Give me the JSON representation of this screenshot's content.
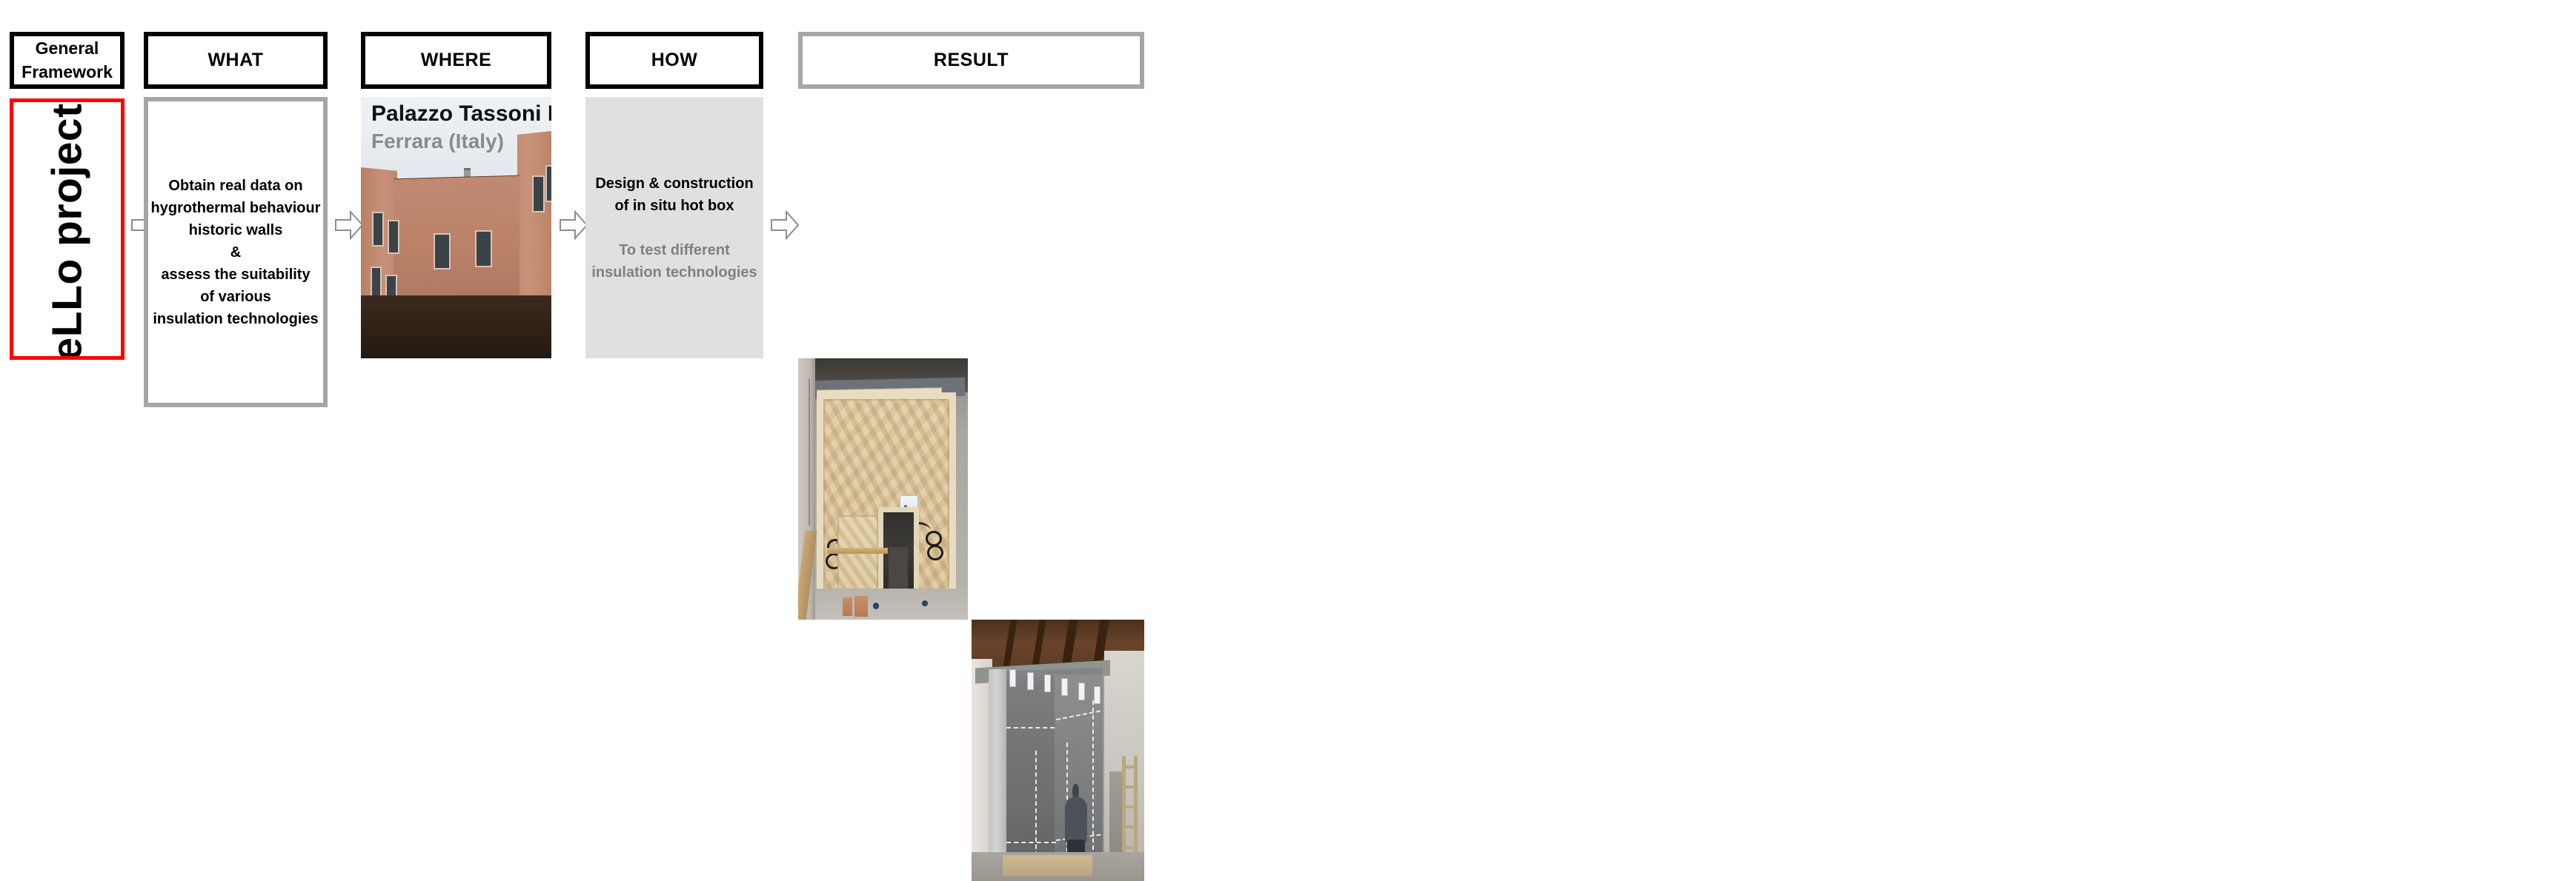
{
  "framework": {
    "header_line1": "General",
    "header_line2": "Framework",
    "goals_label": "The HeLLo project goals",
    "accent_color": "#ff0000"
  },
  "columns": {
    "what": {
      "header": "WHAT",
      "body_lines": [
        "Obtain real data on",
        "hygrothermal behaviour",
        "historic walls",
        "&",
        "assess the suitability",
        "of various",
        "insulation technologies"
      ]
    },
    "where": {
      "header": "WHERE",
      "caption_title": "Palazzo Tassoni Estense",
      "caption_subtitle": "Ferrara (Italy)"
    },
    "how": {
      "header": "HOW",
      "primary_lines": [
        "Design & construction",
        "of in situ hot box"
      ],
      "secondary_lines": [
        "To test different",
        "insulation technologies"
      ]
    },
    "result": {
      "header": "RESULT"
    }
  },
  "arrows": {
    "icon": "arrow-right-icon",
    "count": 4,
    "stroke_color": "#8c8c8c"
  },
  "colors": {
    "header_border_black": "#000000",
    "header_border_gray": "#a6a6a6",
    "panel_fill_gray": "#e0e0e0",
    "muted_text": "#808080"
  }
}
